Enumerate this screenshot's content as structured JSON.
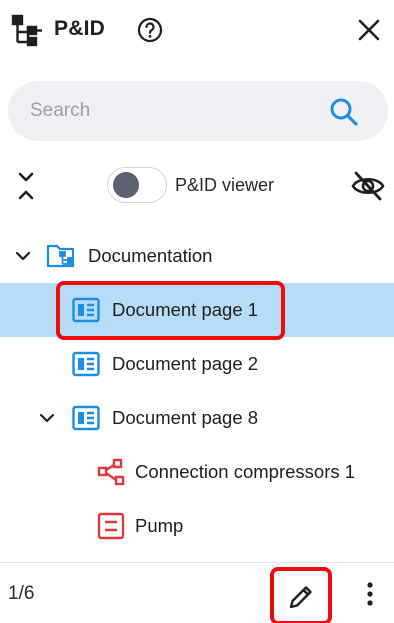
{
  "header": {
    "title": "P&ID",
    "app_icon": "hierarchy-icon",
    "help_icon": "help-circle-icon",
    "close_icon": "close-icon"
  },
  "search": {
    "placeholder": "Search",
    "value": ""
  },
  "controls": {
    "toggle_label": "P&ID viewer",
    "toggle_on": false,
    "visibility_icon": "eye-off-icon"
  },
  "tree": {
    "root": {
      "label": "Documentation",
      "expanded": true
    },
    "items": [
      {
        "label": "Document page 1",
        "selected": true
      },
      {
        "label": "Document page 2",
        "selected": false
      },
      {
        "label": "Document page 8",
        "expanded": true
      },
      {
        "label": "Connection compressors 1"
      },
      {
        "label": "Pump"
      }
    ]
  },
  "footer": {
    "page_count": "1/6"
  },
  "colors": {
    "accent": "#1a8fe3",
    "selected_row": "#b7dcf7",
    "highlight": "#ee0b12",
    "red_icon": "#e5383b"
  }
}
